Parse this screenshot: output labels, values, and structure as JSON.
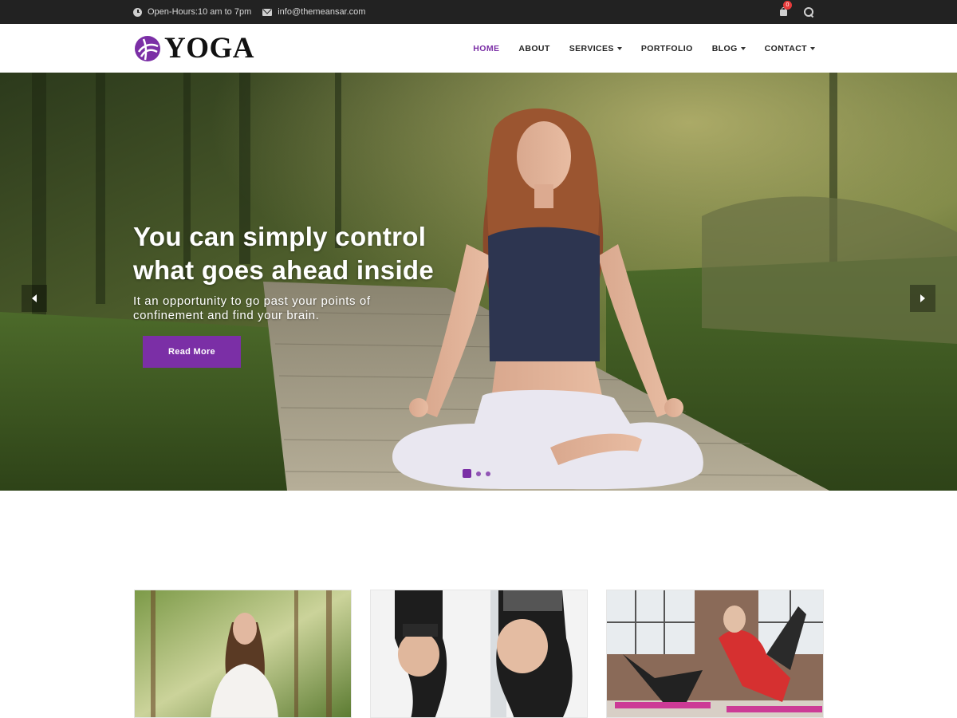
{
  "topbar": {
    "hours": "Open-Hours:10 am to 7pm",
    "email": "info@themeansar.com",
    "cart_count": "0"
  },
  "header": {
    "logo_text": "YOGA",
    "nav": [
      {
        "label": "HOME",
        "active": true
      },
      {
        "label": "ABOUT"
      },
      {
        "label": "SERVICES",
        "dropdown": true
      },
      {
        "label": "PORTFOLIO"
      },
      {
        "label": "BLOG",
        "dropdown": true
      },
      {
        "label": "CONTACT",
        "dropdown": true
      }
    ]
  },
  "hero": {
    "title": "You can simply control what goes ahead inside",
    "subtitle": "It an opportunity to go past your points of confinement and find your brain.",
    "button": "Read More",
    "slides": 3,
    "active_slide": 1
  },
  "colors": {
    "accent": "#7b2fa6",
    "topbar_bg": "#222222",
    "badge": "#e63b3b"
  },
  "icons": [
    "clock-icon",
    "mail-icon",
    "shopping-bag-icon",
    "search-icon",
    "chevron-left-icon",
    "chevron-right-icon"
  ]
}
